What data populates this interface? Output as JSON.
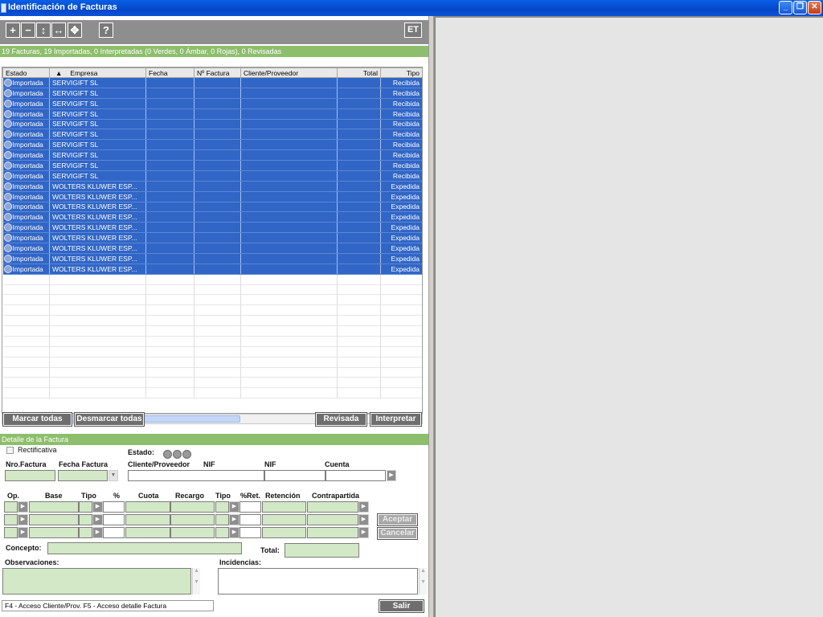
{
  "window": {
    "title": "Identificación de Facturas",
    "minimize": "_",
    "restore": "❐",
    "close": "✕"
  },
  "toolbar": {
    "zoom_in": "+",
    "zoom_out": "−",
    "fit_vertical": "↕",
    "fit_horizontal": "↔",
    "fit_all": "✥",
    "help": "?",
    "et": "ET"
  },
  "summary": "19 Facturas, 19 Importadas, 0 Interpretadas (0 Verdes, 0 Ámbar, 0 Rojas), 0 Revisadas",
  "table": {
    "columns": [
      "Estado",
      "Empresa",
      "Fecha",
      "Nº Factura",
      "Cliente/Proveedor",
      "Total",
      "Tipo"
    ],
    "sort_indicator": "▲",
    "rows": [
      {
        "estado": "Importada",
        "empresa": "SERVIGIFT SL",
        "fecha": "",
        "nfactura": "",
        "cliente": "",
        "total": "",
        "tipo": "Recibida"
      },
      {
        "estado": "Importada",
        "empresa": "SERVIGIFT SL",
        "fecha": "",
        "nfactura": "",
        "cliente": "",
        "total": "",
        "tipo": "Recibida"
      },
      {
        "estado": "Importada",
        "empresa": "SERVIGIFT SL",
        "fecha": "",
        "nfactura": "",
        "cliente": "",
        "total": "",
        "tipo": "Recibida"
      },
      {
        "estado": "Importada",
        "empresa": "SERVIGIFT SL",
        "fecha": "",
        "nfactura": "",
        "cliente": "",
        "total": "",
        "tipo": "Recibida"
      },
      {
        "estado": "Importada",
        "empresa": "SERVIGIFT SL",
        "fecha": "",
        "nfactura": "",
        "cliente": "",
        "total": "",
        "tipo": "Recibida"
      },
      {
        "estado": "Importada",
        "empresa": "SERVIGIFT SL",
        "fecha": "",
        "nfactura": "",
        "cliente": "",
        "total": "",
        "tipo": "Recibida"
      },
      {
        "estado": "Importada",
        "empresa": "SERVIGIFT SL",
        "fecha": "",
        "nfactura": "",
        "cliente": "",
        "total": "",
        "tipo": "Recibida"
      },
      {
        "estado": "Importada",
        "empresa": "SERVIGIFT SL",
        "fecha": "",
        "nfactura": "",
        "cliente": "",
        "total": "",
        "tipo": "Recibida"
      },
      {
        "estado": "Importada",
        "empresa": "SERVIGIFT SL",
        "fecha": "",
        "nfactura": "",
        "cliente": "",
        "total": "",
        "tipo": "Recibida"
      },
      {
        "estado": "Importada",
        "empresa": "SERVIGIFT SL",
        "fecha": "",
        "nfactura": "",
        "cliente": "",
        "total": "",
        "tipo": "Recibida"
      },
      {
        "estado": "Importada",
        "empresa": "WOLTERS KLUWER ESP...",
        "fecha": "",
        "nfactura": "",
        "cliente": "",
        "total": "",
        "tipo": "Expedida"
      },
      {
        "estado": "Importada",
        "empresa": "WOLTERS KLUWER ESP...",
        "fecha": "",
        "nfactura": "",
        "cliente": "",
        "total": "",
        "tipo": "Expedida"
      },
      {
        "estado": "Importada",
        "empresa": "WOLTERS KLUWER ESP...",
        "fecha": "",
        "nfactura": "",
        "cliente": "",
        "total": "",
        "tipo": "Expedida"
      },
      {
        "estado": "Importada",
        "empresa": "WOLTERS KLUWER ESP...",
        "fecha": "",
        "nfactura": "",
        "cliente": "",
        "total": "",
        "tipo": "Expedida"
      },
      {
        "estado": "Importada",
        "empresa": "WOLTERS KLUWER ESP...",
        "fecha": "",
        "nfactura": "",
        "cliente": "",
        "total": "",
        "tipo": "Expedida"
      },
      {
        "estado": "Importada",
        "empresa": "WOLTERS KLUWER ESP...",
        "fecha": "",
        "nfactura": "",
        "cliente": "",
        "total": "",
        "tipo": "Expedida"
      },
      {
        "estado": "Importada",
        "empresa": "WOLTERS KLUWER ESP...",
        "fecha": "",
        "nfactura": "",
        "cliente": "",
        "total": "",
        "tipo": "Expedida"
      },
      {
        "estado": "Importada",
        "empresa": "WOLTERS KLUWER ESP...",
        "fecha": "",
        "nfactura": "",
        "cliente": "",
        "total": "",
        "tipo": "Expedida"
      },
      {
        "estado": "Importada",
        "empresa": "WOLTERS KLUWER ESP...",
        "fecha": "",
        "nfactura": "",
        "cliente": "",
        "total": "",
        "tipo": "Expedida"
      }
    ]
  },
  "buttons": {
    "marcar_todas": "Marcar todas",
    "desmarcar_todas": "Desmarcar todas",
    "revisada": "Revisada",
    "interpretar": "Interpretar",
    "aceptar": "Aceptar",
    "cancelar": "Cancelar",
    "salir": "Salir"
  },
  "detail": {
    "header": "Detalle de la Factura",
    "rectificativa": "Rectificativa",
    "estado": "Estado:",
    "nro_factura": "Nro.Factura",
    "fecha_factura": "Fecha Factura",
    "cliente_proveedor": "Cliente/Proveedor",
    "nif1": "NIF",
    "nif2": "NIF",
    "cuenta": "Cuenta",
    "tax_headers": {
      "op": "Op.",
      "base": "Base",
      "tipo": "Tipo",
      "pct": "%",
      "cuota": "Cuota",
      "recargo": "Recargo",
      "tipo2": "Tipo",
      "ret_pct": "%Ret.",
      "retencion": "Retención",
      "contrapartida": "Contrapartida"
    },
    "concepto": "Concepto:",
    "total": "Total:",
    "observaciones": "Observaciones:",
    "incidencias": "Incidencias:"
  },
  "status": "F4 - Acceso Cliente/Prov. F5 - Acceso detalle Factura",
  "colors": {
    "selected_row": "#3166c6",
    "green_header": "#8dbe6c",
    "input_green": "#d3e8c6",
    "toolbar_gray": "#8e8e8e"
  }
}
